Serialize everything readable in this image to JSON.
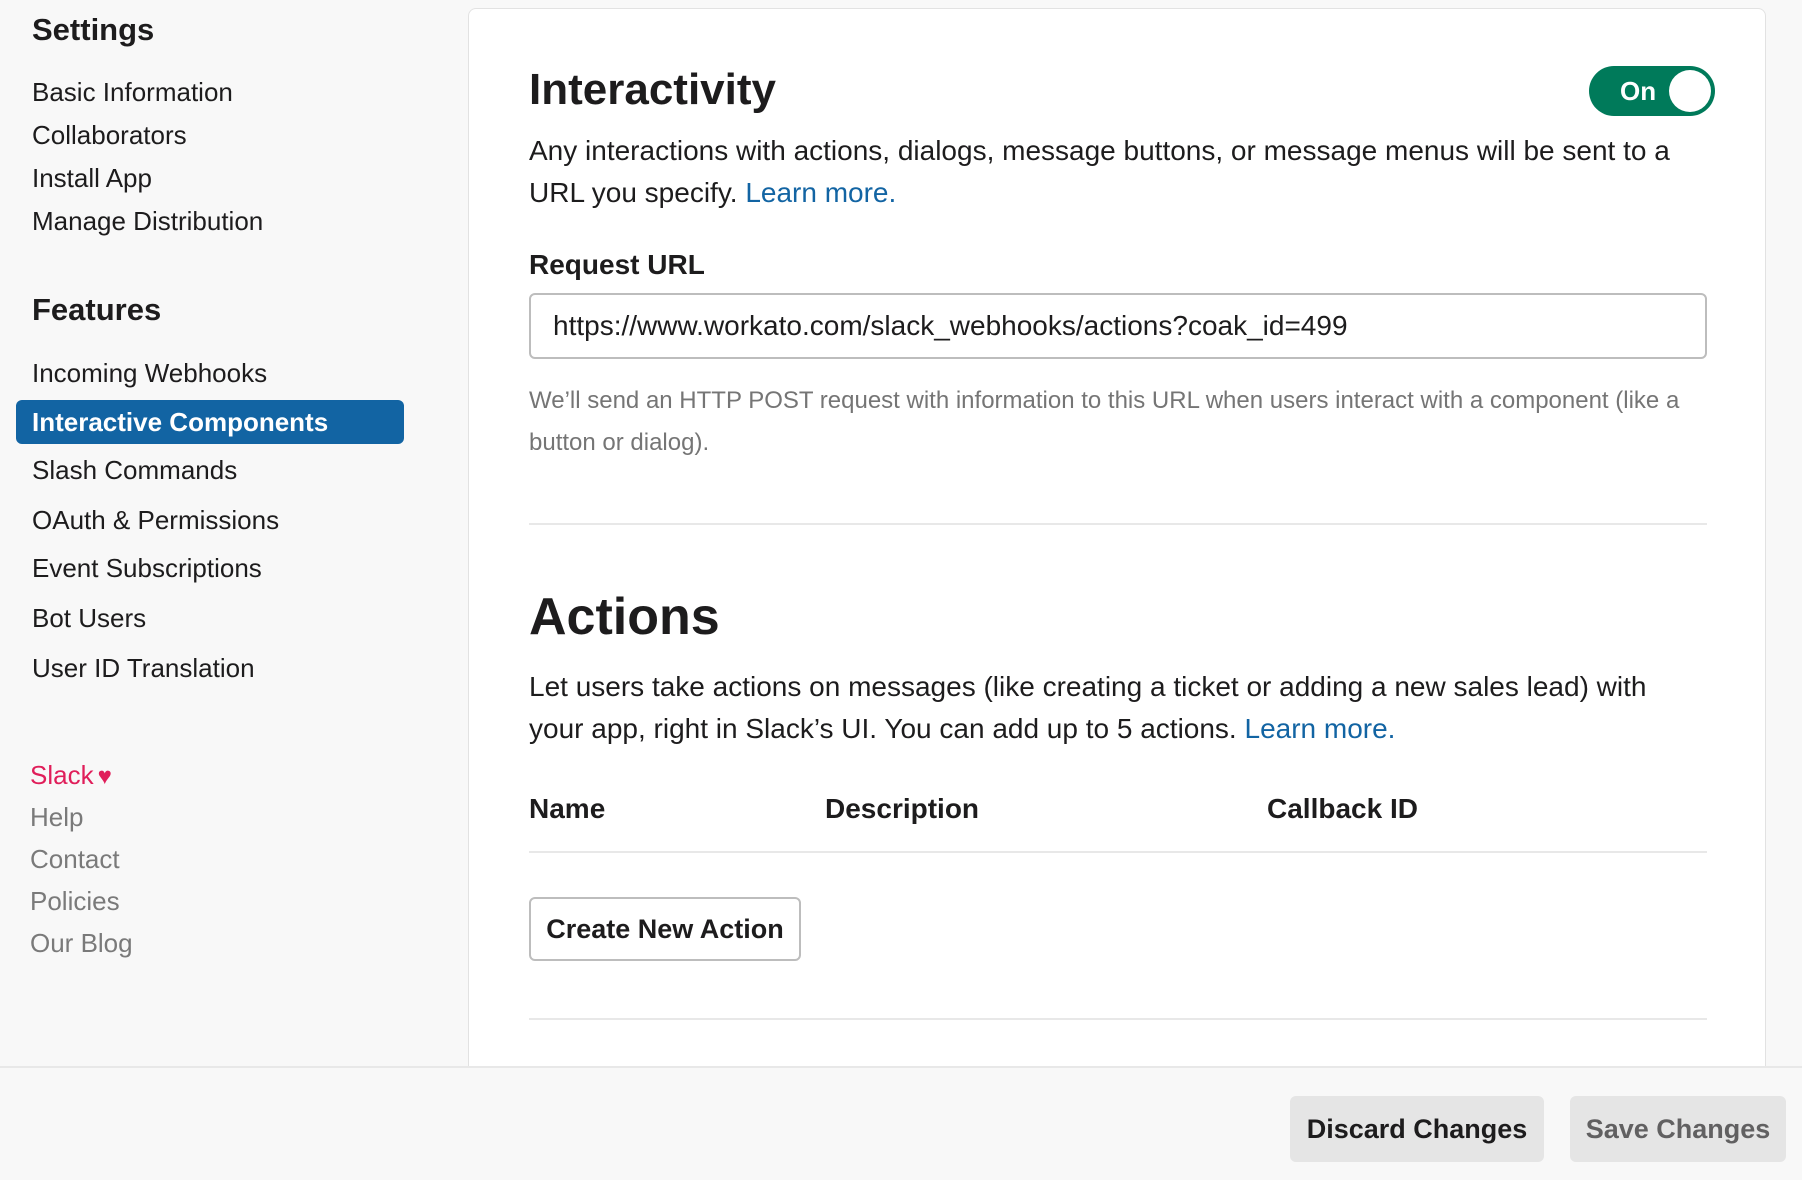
{
  "sidebar": {
    "settings_heading": "Settings",
    "settings_items": [
      {
        "label": "Basic Information"
      },
      {
        "label": "Collaborators"
      },
      {
        "label": "Install App"
      },
      {
        "label": "Manage Distribution"
      }
    ],
    "features_heading": "Features",
    "features_items": [
      {
        "label": "Incoming Webhooks",
        "active": false
      },
      {
        "label": "Interactive Components",
        "active": true
      },
      {
        "label": "Slash Commands",
        "active": false
      },
      {
        "label": "OAuth & Permissions",
        "active": false
      },
      {
        "label": "Event Subscriptions",
        "active": false
      },
      {
        "label": "Bot Users",
        "active": false
      },
      {
        "label": "User ID Translation",
        "active": false
      }
    ],
    "footer": {
      "brand": "Slack",
      "heart_icon": "heart-icon",
      "links": [
        "Help",
        "Contact",
        "Policies",
        "Our Blog"
      ]
    }
  },
  "interactivity": {
    "title": "Interactivity",
    "toggle_label": "On",
    "toggle_state": true,
    "description": "Any interactions with actions, dialogs, message buttons, or message menus will be sent to a URL you specify.",
    "learn_more": "Learn more.",
    "request_url_label": "Request URL",
    "request_url_value": "https://www.workato.com/slack_webhooks/actions?coak_id=499",
    "hint": "We’ll send an HTTP POST request with information to this URL when users interact with a component (like a button or dialog)."
  },
  "actions": {
    "title": "Actions",
    "description": "Let users take actions on messages (like creating a ticket or adding a new sales lead) with your app, right in Slack’s UI. You can add up to 5 actions.",
    "learn_more": "Learn more.",
    "columns": [
      "Name",
      "Description",
      "Callback ID"
    ],
    "create_button": "Create New Action"
  },
  "bottom_bar": {
    "discard_label": "Discard Changes",
    "save_label": "Save Changes"
  },
  "colors": {
    "accent_blue": "#1264a3",
    "toggle_green": "#007a5a",
    "brand_red": "#e01e5a"
  }
}
